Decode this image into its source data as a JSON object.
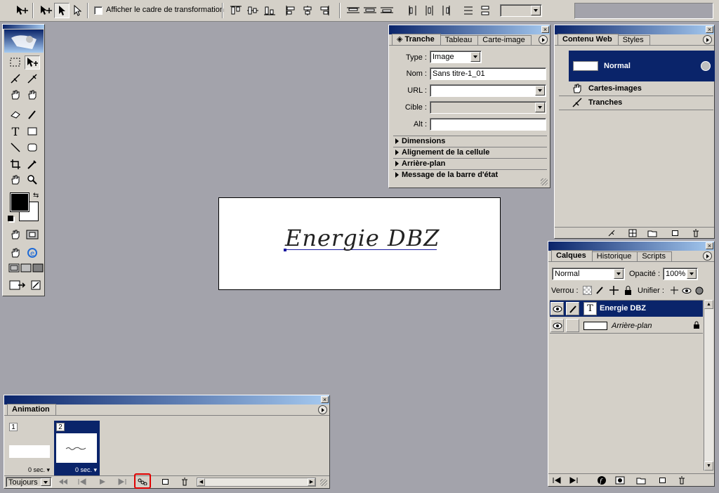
{
  "options_bar": {
    "show_transform_label": "Afficher le cadre de transformation"
  },
  "slice_panel": {
    "tabs": [
      "Tranche",
      "Tableau",
      "Carte-image"
    ],
    "type_label": "Type :",
    "type_value": "Image",
    "name_label": "Nom :",
    "name_value": "Sans titre-1_01",
    "url_label": "URL :",
    "url_value": "",
    "target_label": "Cible :",
    "target_value": "",
    "alt_label": "Alt :",
    "alt_value": "",
    "sections": [
      "Dimensions",
      "Alignement de la cellule",
      "Arrière-plan",
      "Message de la barre d'état"
    ]
  },
  "web_panel": {
    "tabs": [
      "Contenu Web",
      "Styles"
    ],
    "items": {
      "normal": "Normal",
      "image_maps": "Cartes-images",
      "slices": "Tranches"
    }
  },
  "layers_panel": {
    "tabs": [
      "Calques",
      "Historique",
      "Scripts"
    ],
    "blend_mode": "Normal",
    "opacity_label": "Opacité :",
    "opacity_value": "100%",
    "lock_label": "Verrou :",
    "unify_label": "Unifier :",
    "layers": [
      "Energie DBZ",
      "Arrière-plan"
    ]
  },
  "animation_panel": {
    "tab": "Animation",
    "frames": [
      {
        "number": "1",
        "delay": "0 sec."
      },
      {
        "number": "2",
        "delay": "0 sec."
      }
    ],
    "loop": "Toujours"
  },
  "canvas": {
    "text": "Energie DBZ"
  },
  "colors": {
    "selection": "#0a246a",
    "panel_bg": "#d4d0c8",
    "workspace": "#a3a3ab",
    "highlight_box": "#e00000"
  }
}
